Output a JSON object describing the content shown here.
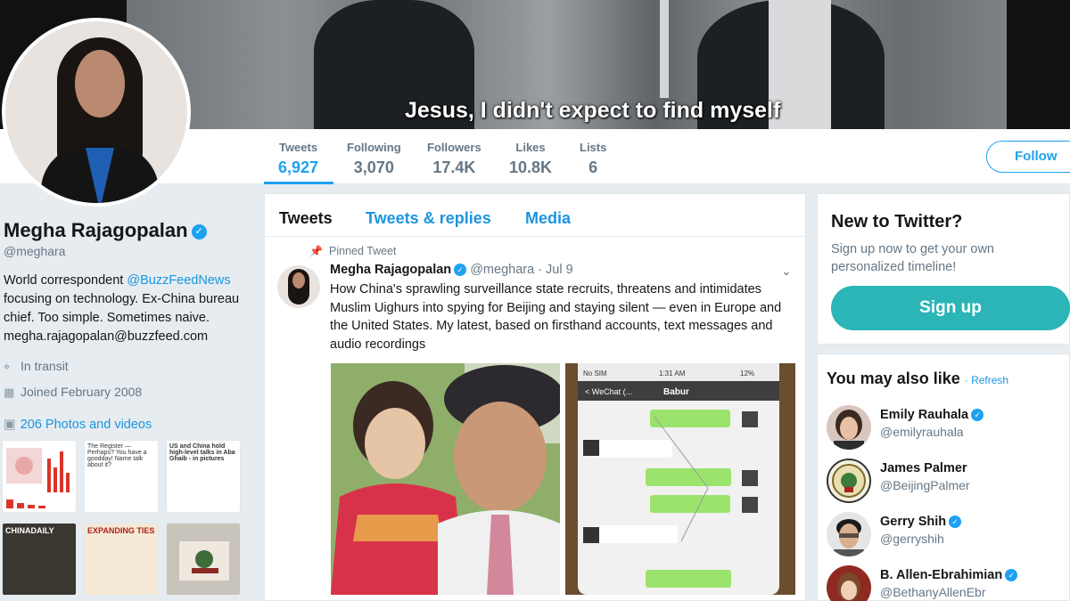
{
  "banner": {
    "caption": "Jesus, I didn't expect to find myself"
  },
  "stats": [
    {
      "label": "Tweets",
      "value": "6,927"
    },
    {
      "label": "Following",
      "value": "3,070"
    },
    {
      "label": "Followers",
      "value": "17.4K"
    },
    {
      "label": "Likes",
      "value": "10.8K"
    },
    {
      "label": "Lists",
      "value": "6"
    }
  ],
  "follow_label": "Follow",
  "profile": {
    "name": "Megha Rajagopalan",
    "handle": "@meghara",
    "bio_line1_prefix": "World correspondent ",
    "bio_link": "@BuzzFeedNews",
    "bio_rest1": "focusing on technology. Ex-China bureau",
    "bio_rest2": "chief. Too simple. Sometimes naive.",
    "bio_rest3": "megha.rajagopalan@buzzfeed.com",
    "location": "In transit",
    "joined": "Joined February 2008",
    "photos": "206 Photos and videos"
  },
  "thumbs": {
    "t2": "The Register — Perhaps? You have a goodday! Name talk about it?",
    "t3": "US and China hold high-level talks in Aba Ghaib - in pictures",
    "t4": "CHINADAILY",
    "t5": "EXPANDING TIES"
  },
  "tabs": {
    "tweets": "Tweets",
    "replies": "Tweets & replies",
    "media": "Media"
  },
  "tweet": {
    "pinned": "Pinned Tweet",
    "author": "Megha Rajagopalan",
    "handle": "@meghara",
    "date": "· Jul 9",
    "text": "How China's sprawling surveillance state recruits, threatens and intimidates Muslim Uighurs into spying for Beijing and staying silent — even in Europe and the United States. My latest, based on firsthand accounts, text messages and audio recordings"
  },
  "phone": {
    "carrier": "No SIM",
    "time": "1:31 AM",
    "battery": "12%",
    "back": "< WeChat (...",
    "contact": "Babur"
  },
  "new_to_twitter": {
    "title": "New to Twitter?",
    "subtitle": "Sign up now to get your own personalized timeline!",
    "signup": "Sign up"
  },
  "you_may_like": {
    "title": "You may also like",
    "refresh": "· Refresh",
    "users": [
      {
        "name": "Emily Rauhala",
        "handle": "@emilyrauhala",
        "verified": true
      },
      {
        "name": "James Palmer",
        "handle": "@BeijingPalmer",
        "verified": false
      },
      {
        "name": "Gerry Shih",
        "handle": "@gerryshih",
        "verified": true
      },
      {
        "name": "B. Allen-Ebrahimian",
        "handle": "@BethanyAllenEbr",
        "verified": true
      }
    ]
  },
  "colors": {
    "accent": "#1da1f2",
    "signup": "#2bb5b7",
    "background": "#e6ecf0"
  }
}
